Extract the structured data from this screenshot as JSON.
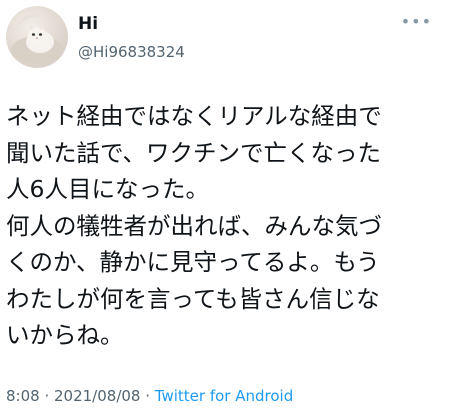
{
  "user": {
    "display_name": "Hi",
    "handle": "@Hi96838324"
  },
  "menu_icon": "more-horizontal-icon",
  "avatar_icon": "cat-photo-avatar",
  "tweet": {
    "text": "ネット経由ではなくリアルな経由で\n聞いた話で、ワクチンで亡くなった\n人6人目になった。\n何人の犠牲者が出れば、みんな気づ\nくのか、静かに見守ってるよ。もう\nわたしが何を言っても皆さん信じな\nいからね。",
    "time": "8:08",
    "separator1": " · ",
    "date": "2021/08/08",
    "separator2": " · ",
    "source": "Twitter for Android"
  },
  "colors": {
    "text": "#0f1419",
    "secondary": "#536471",
    "link": "#1d9bf0"
  }
}
